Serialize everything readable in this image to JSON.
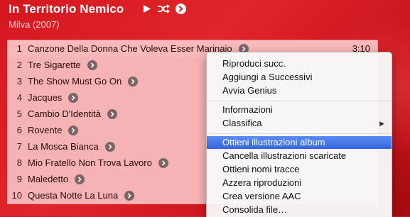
{
  "album": {
    "title": "In Territorio Nemico",
    "subtitle": "Milva (2007)"
  },
  "header_icons": [
    "play-icon",
    "shuffle-icon",
    "go-arrow-icon"
  ],
  "tracks": [
    {
      "num": "1",
      "name": "Canzone Della Donna Che Voleva Esser Marinaio",
      "duration": "3:10"
    },
    {
      "num": "2",
      "name": "Tre Sigarette",
      "duration": ""
    },
    {
      "num": "3",
      "name": "The Show Must Go On",
      "duration": ""
    },
    {
      "num": "4",
      "name": "Jacques",
      "duration": ""
    },
    {
      "num": "5",
      "name": "Cambio D'Identità",
      "duration": ""
    },
    {
      "num": "6",
      "name": "Rovente",
      "duration": ""
    },
    {
      "num": "7",
      "name": "La Mosca Bianca",
      "duration": ""
    },
    {
      "num": "8",
      "name": "Mio Fratello Non Trova Lavoro",
      "duration": ""
    },
    {
      "num": "9",
      "name": "Maledetto",
      "duration": ""
    },
    {
      "num": "10",
      "name": "Questa Notte La Luna",
      "duration": ""
    }
  ],
  "context_menu": {
    "items": [
      {
        "label": "Riproduci succ."
      },
      {
        "label": "Aggiungi a Successivi"
      },
      {
        "label": "Avvia Genius"
      },
      {
        "label": "Informazioni"
      },
      {
        "label": "Classifica",
        "submenu": "▶"
      },
      {
        "label": "Ottieni illustrazioni album",
        "highlighted": true
      },
      {
        "label": "Cancella illustrazioni scaricate"
      },
      {
        "label": "Ottieni nomi tracce"
      },
      {
        "label": "Azzera riproduzioni"
      },
      {
        "label": "Crea versione AAC"
      },
      {
        "label": "Consolida file…"
      }
    ]
  },
  "colors": {
    "background": "#d4171f",
    "list_bg": "#f6b3b5",
    "menu_highlight": "#3d6fe6"
  }
}
